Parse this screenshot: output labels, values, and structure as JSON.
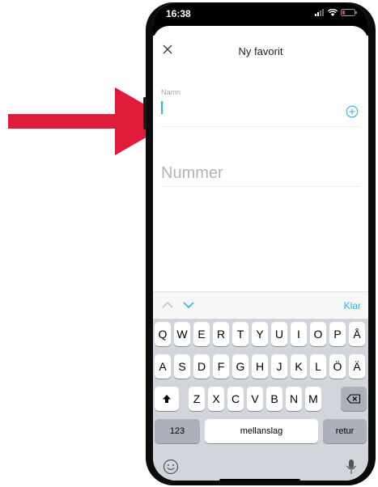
{
  "status_bar": {
    "time": "16:38"
  },
  "nav": {
    "title": "Ny favorit"
  },
  "form": {
    "name_label": "Namn",
    "name_value": "",
    "number_placeholder": "Nummer"
  },
  "accessory": {
    "done_label": "Klar"
  },
  "keyboard": {
    "row1": [
      "Q",
      "W",
      "E",
      "R",
      "T",
      "Y",
      "U",
      "I",
      "O",
      "P",
      "Å"
    ],
    "row2": [
      "A",
      "S",
      "D",
      "F",
      "G",
      "H",
      "J",
      "K",
      "L",
      "Ö",
      "Ä"
    ],
    "row3": [
      "Z",
      "X",
      "C",
      "V",
      "B",
      "N",
      "M"
    ],
    "numbers_label": "123",
    "space_label": "mellanslag",
    "return_label": "retur"
  },
  "colors": {
    "accent": "#2ab6e8",
    "arrow": "#e11b3a"
  }
}
